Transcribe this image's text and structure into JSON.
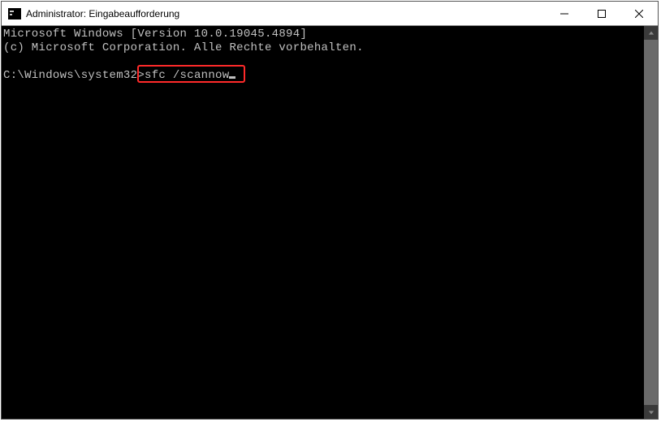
{
  "window": {
    "title": "Administrator: Eingabeaufforderung"
  },
  "terminal": {
    "line1": "Microsoft Windows [Version 10.0.19045.4894]",
    "line2": "(c) Microsoft Corporation. Alle Rechte vorbehalten.",
    "blank": "",
    "prompt": "C:\\Windows\\system32>",
    "command": "sfc /scannow"
  }
}
